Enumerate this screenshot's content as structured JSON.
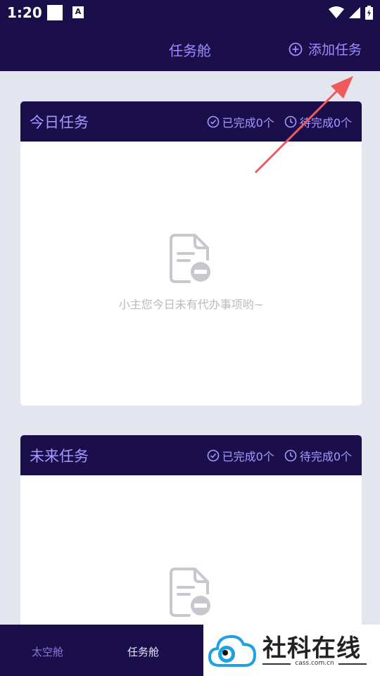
{
  "status_bar": {
    "time": "1:20",
    "a_badge": "A"
  },
  "header": {
    "title": "任务舱",
    "add_task_label": "添加任务"
  },
  "cards": [
    {
      "title": "今日任务",
      "completed": "已完成0个",
      "pending": "待完成0个",
      "empty_text": "小主您今日未有代办事项哟~"
    },
    {
      "title": "未来任务",
      "completed": "已完成0个",
      "pending": "待完成0个"
    }
  ],
  "tab_bar": {
    "items": [
      {
        "label": "太空舱"
      },
      {
        "label": "任务舱"
      }
    ]
  },
  "watermark": {
    "text": "社科在线",
    "sub": "cass.com.cn"
  },
  "colors": {
    "primary": "#1b0f4b",
    "accent": "#9f8bff",
    "background": "#e3e6ee",
    "annotation_arrow": "#f05a5a"
  }
}
